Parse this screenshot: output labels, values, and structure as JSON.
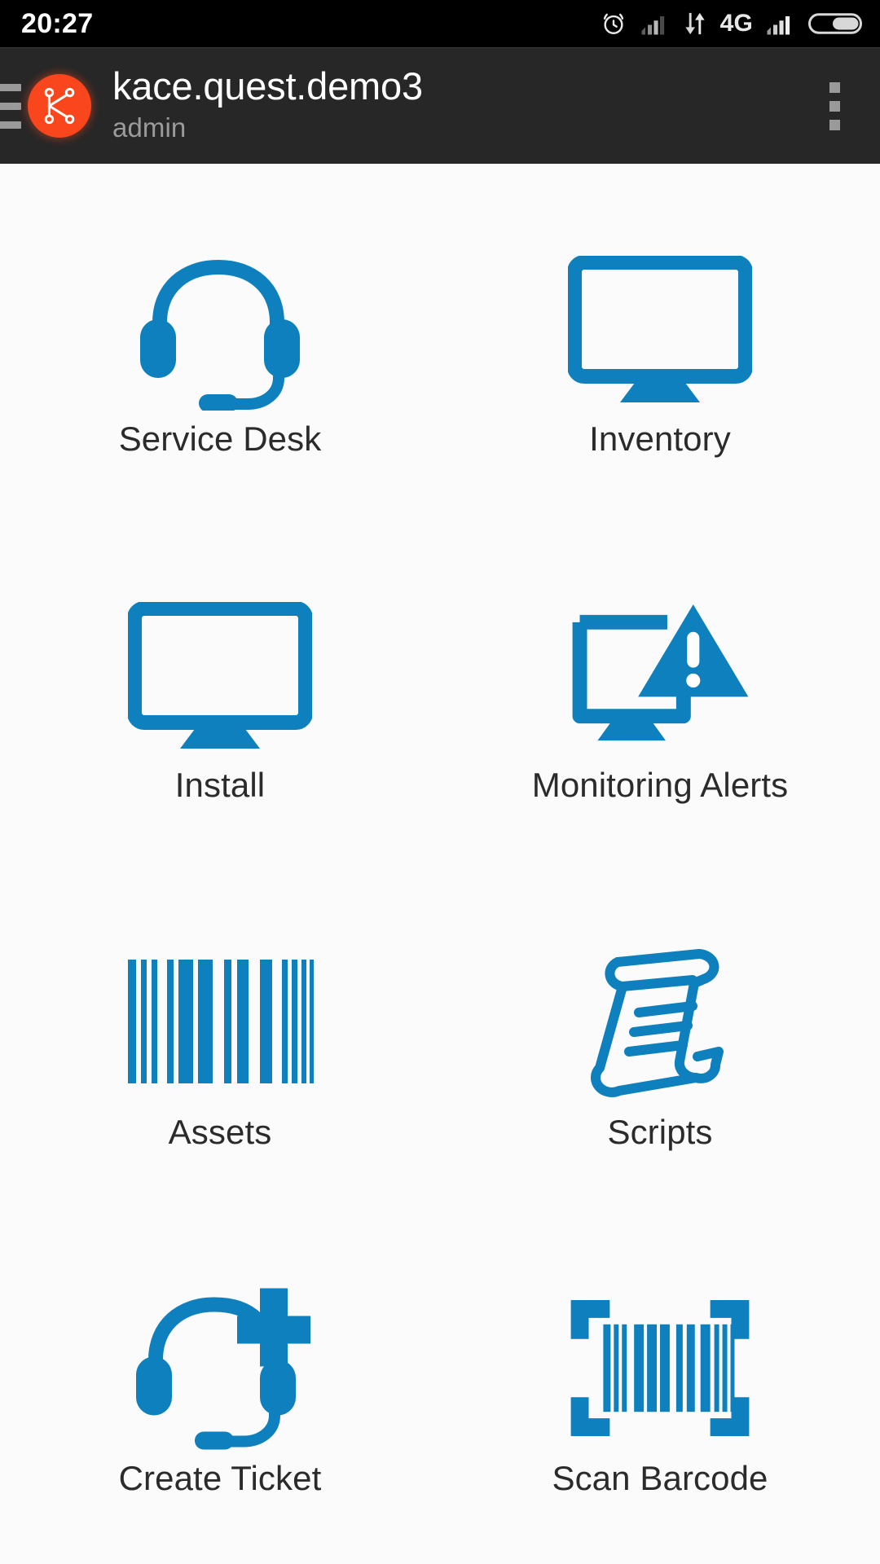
{
  "status_bar": {
    "clock": "20:27",
    "network_label": "4G",
    "icons": [
      "alarm-clock-icon",
      "signal-bars-dim-icon",
      "data-transfer-icon",
      "signal-bars-icon",
      "battery-icon"
    ]
  },
  "app_bar": {
    "menu_icon": "hamburger-menu-icon",
    "logo_icon": "kace-logo-icon",
    "title": "kace.quest.demo3",
    "subtitle": "admin",
    "overflow_icon": "overflow-menu-icon"
  },
  "grid": {
    "tiles": [
      {
        "label": "Service Desk",
        "icon": "headset-icon"
      },
      {
        "label": "Inventory",
        "icon": "monitor-icon"
      },
      {
        "label": "Install",
        "icon": "monitor-icon"
      },
      {
        "label": "Monitoring Alerts",
        "icon": "monitor-alert-icon"
      },
      {
        "label": "Assets",
        "icon": "barcode-icon"
      },
      {
        "label": "Scripts",
        "icon": "scroll-icon"
      },
      {
        "label": "Create Ticket",
        "icon": "headset-plus-icon"
      },
      {
        "label": "Scan Barcode",
        "icon": "barcode-scan-icon"
      }
    ]
  },
  "colors": {
    "accent_blue": "#0d80bd",
    "brand_orange": "#f9461c",
    "status_bar_bg": "#000000",
    "app_bar_bg": "#272727",
    "content_bg": "#fbfbfb",
    "label_text": "#2b2b2b",
    "subtitle_text": "#9b9b9b"
  }
}
